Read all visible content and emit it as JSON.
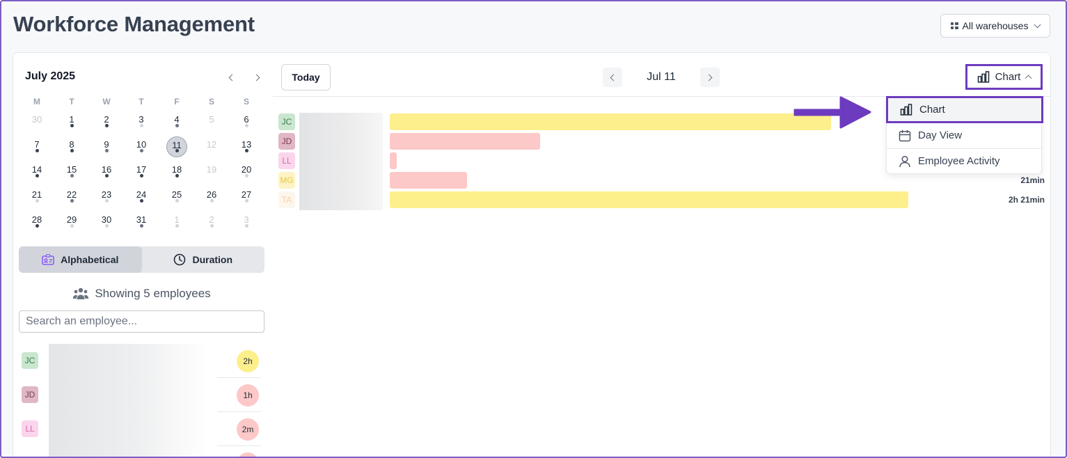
{
  "app": {
    "title": "Workforce Management",
    "warehouse_selector": {
      "label": "All warehouses",
      "icon": "grid-icon"
    }
  },
  "calendar": {
    "month_label": "July 2025",
    "weekday_headers": [
      "M",
      "T",
      "W",
      "T",
      "F",
      "S",
      "S"
    ],
    "weeks": [
      [
        {
          "d": "30",
          "muted": true,
          "dot": "none"
        },
        {
          "d": "1",
          "dot": "dark"
        },
        {
          "d": "2",
          "dot": "dark"
        },
        {
          "d": "3",
          "dot": "light"
        },
        {
          "d": "4",
          "dot": "mid"
        },
        {
          "d": "5",
          "muted": true,
          "dot": "none"
        },
        {
          "d": "6",
          "dot": "light"
        }
      ],
      [
        {
          "d": "7",
          "dot": "dark"
        },
        {
          "d": "8",
          "dot": "dark"
        },
        {
          "d": "9",
          "dot": "mid"
        },
        {
          "d": "10",
          "dot": "mid"
        },
        {
          "d": "11",
          "selected": true,
          "dot": "dark"
        },
        {
          "d": "12",
          "muted": true,
          "dot": "none"
        },
        {
          "d": "13",
          "dot": "dark"
        }
      ],
      [
        {
          "d": "14",
          "dot": "dark"
        },
        {
          "d": "15",
          "dot": "mid"
        },
        {
          "d": "16",
          "dot": "dark"
        },
        {
          "d": "17",
          "dot": "dark"
        },
        {
          "d": "18",
          "dot": "dark"
        },
        {
          "d": "19",
          "muted": true,
          "dot": "none"
        },
        {
          "d": "20",
          "dot": "light"
        }
      ],
      [
        {
          "d": "21",
          "dot": "light"
        },
        {
          "d": "22",
          "dot": "mid"
        },
        {
          "d": "23",
          "dot": "light"
        },
        {
          "d": "24",
          "dot": "dark"
        },
        {
          "d": "25",
          "dot": "light"
        },
        {
          "d": "26",
          "dot": "light"
        },
        {
          "d": "27",
          "dot": "light"
        }
      ],
      [
        {
          "d": "28",
          "dot": "dark"
        },
        {
          "d": "29",
          "dot": "light"
        },
        {
          "d": "30",
          "dot": "light"
        },
        {
          "d": "31",
          "dot": "mid"
        },
        {
          "d": "1",
          "muted": true,
          "dot": "light"
        },
        {
          "d": "2",
          "muted": true,
          "dot": "light"
        },
        {
          "d": "3",
          "muted": true,
          "dot": "light"
        }
      ]
    ]
  },
  "sort": {
    "alphabetical_label": "Alphabetical",
    "duration_label": "Duration",
    "active": "alphabetical"
  },
  "employees_summary": "Showing 5 employees",
  "search": {
    "placeholder": "Search an employee...",
    "value": ""
  },
  "employee_list": [
    {
      "initials": "JC",
      "badge": "2h",
      "avatar_bg": "#c9e6cf",
      "avatar_fg": "#3d7a4c",
      "badge_bg": "#fdef8b"
    },
    {
      "initials": "JD",
      "badge": "1h",
      "avatar_bg": "#e0b7c4",
      "avatar_fg": "#7a3d52",
      "badge_bg": "#fdc8c8"
    },
    {
      "initials": "LL",
      "badge": "2m",
      "avatar_bg": "#fbd5ec",
      "avatar_fg": "#d468ad",
      "badge_bg": "#fdc8c8"
    }
  ],
  "toolbar": {
    "today_label": "Today",
    "date_label": "Jul 11",
    "view_button_label": "Chart"
  },
  "chart_rows": [
    {
      "initials": "JC",
      "avatar_bg": "#c9e6cf",
      "avatar_fg": "#3d7a4c",
      "bar_color": "#fdef8b",
      "bar_frac": 0.851,
      "label": ""
    },
    {
      "initials": "JD",
      "avatar_bg": "#e0b7c4",
      "avatar_fg": "#7a3d52",
      "bar_color": "#fdc8c8",
      "bar_frac": 0.29,
      "label": ""
    },
    {
      "initials": "LL",
      "avatar_bg": "#fbd5ec",
      "avatar_fg": "#d468ad",
      "bar_color": "#fdc8c8",
      "bar_frac": 0.013,
      "label": ""
    },
    {
      "initials": "MG",
      "avatar_bg": "#fdf3c4",
      "avatar_fg": "#e8c948",
      "bar_color": "#fdc8c8",
      "bar_frac": 0.149,
      "label": "21min"
    },
    {
      "initials": "TA",
      "avatar_bg": "#fdf6ec",
      "avatar_fg": "#f5cfa8",
      "bar_color": "#fdef8b",
      "bar_frac": 1.0,
      "label": "2h 21min"
    }
  ],
  "view_menu": {
    "items": [
      {
        "label": "Chart",
        "icon": "bar-chart-icon",
        "highlighted": true
      },
      {
        "label": "Day View",
        "icon": "calendar-icon",
        "highlighted": false
      },
      {
        "label": "Employee Activity",
        "icon": "user-icon",
        "highlighted": false
      }
    ]
  },
  "colors": {
    "highlight": "#6d3bbf",
    "arrow": "#6d3bbf"
  }
}
